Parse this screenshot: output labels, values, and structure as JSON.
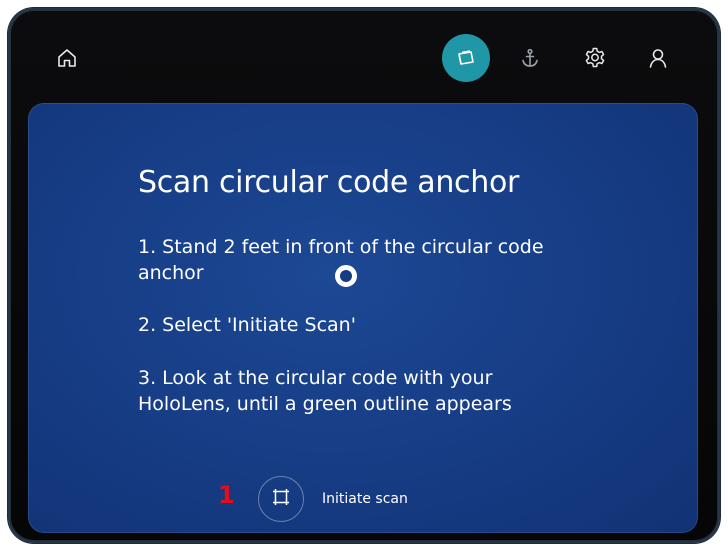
{
  "toolbar": {
    "items": [
      {
        "icon": "home-icon"
      },
      {
        "icon": "hologram-icon",
        "active": true,
        "accent": "#1f97a6"
      },
      {
        "icon": "anchor-icon"
      },
      {
        "icon": "gear-icon"
      },
      {
        "icon": "user-icon"
      }
    ]
  },
  "panel": {
    "background": "#163c84",
    "title": "Scan circular code anchor",
    "steps": [
      "1. Stand 2 feet in front of the circular code anchor",
      "2. Select 'Initiate Scan'",
      "3. Look at the circular code with your HoloLens, until a green outline appears"
    ]
  },
  "action": {
    "callout": "1",
    "callout_color": "#e0101a",
    "icon": "scan-frame-icon",
    "label": "Initiate scan"
  }
}
